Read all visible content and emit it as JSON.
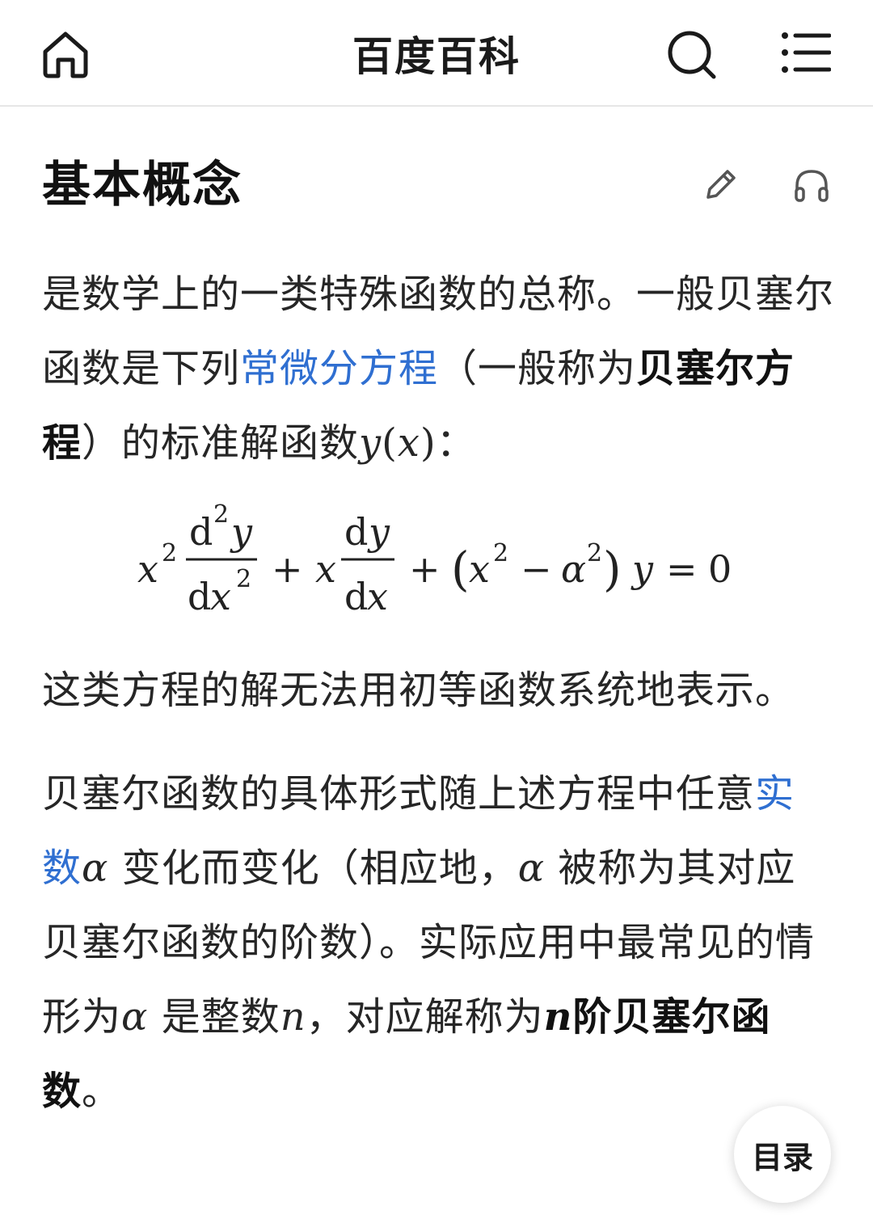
{
  "header": {
    "title": "百度百科",
    "icons": [
      "home-icon",
      "search-icon",
      "menu-icon"
    ]
  },
  "section": {
    "title": "基本概念",
    "icons": [
      "edit-icon",
      "headphones-icon"
    ]
  },
  "paragraph1": {
    "t1": "是数学上的一类特殊函数的总称。一般贝塞尔函数是下列",
    "link": "常微分方程",
    "t2": "（一般称为",
    "bold": "贝塞尔方程",
    "t3": "）的标准解函数",
    "var_y": "y",
    "paren_open": "(",
    "var_x": "x",
    "paren_close": ")",
    "t4": "："
  },
  "equation": {
    "x": "x",
    "sup2": "2",
    "d": "d",
    "y": "y",
    "plus": "+",
    "minus": "−",
    "lparen": "(",
    "rparen": ")",
    "alpha": "α",
    "equals": "=",
    "zero": "0"
  },
  "paragraph2": {
    "text": "这类方程的解无法用初等函数系统地表示。"
  },
  "paragraph3": {
    "t1": "贝塞尔函数的具体形式随上述方程中任意",
    "link": "实数",
    "alpha1": "α",
    "t2": " 变化而变化（相应地，",
    "alpha2": "α",
    "t3": " 被称为其对应贝塞尔函数的阶数）。实际应用中最常见的情形为",
    "alpha3": "α",
    "t4": " 是整数",
    "n1": "n",
    "t5": "，对应解称为",
    "bold_n": "n",
    "bold_text": "阶贝塞尔函数",
    "t6": "。"
  },
  "toc": {
    "label": "目录"
  }
}
